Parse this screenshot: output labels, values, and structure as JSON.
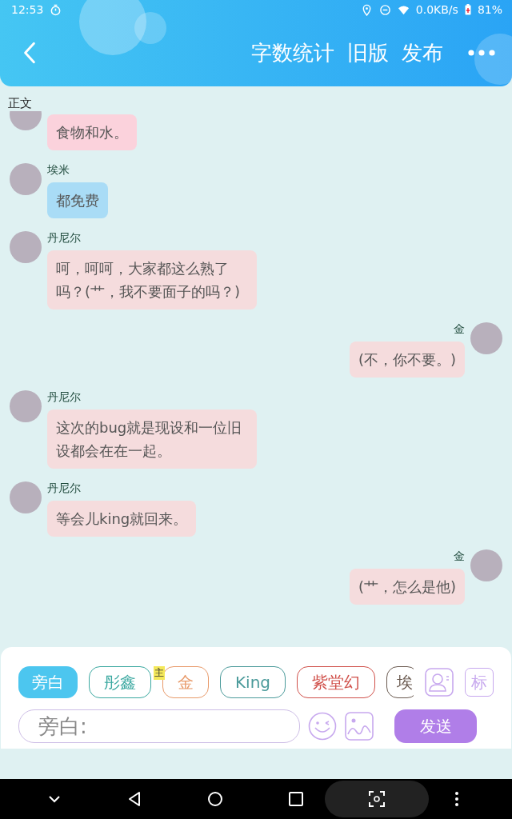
{
  "status_bar": {
    "time": "12:53",
    "network_speed": "0.0KB/s",
    "battery": "81%"
  },
  "header": {
    "actions": [
      "字数统计",
      "旧版",
      "发布"
    ]
  },
  "section_label": "正文",
  "messages": [
    {
      "kind": "left",
      "text": "食物和水。",
      "color": "#fbd2dc"
    },
    {
      "kind": "left",
      "name": "埃米",
      "text": "都免费",
      "color": "#a9dcf6"
    },
    {
      "kind": "left",
      "name": "丹尼尔",
      "text": "呵，呵呵，大家都这么熟了吗？(艹，我不要面子的吗？)",
      "color": "#f5dcdd"
    },
    {
      "kind": "right",
      "name": "金",
      "text": "(不，你不要。)",
      "color": "#f5dcdd"
    },
    {
      "kind": "left",
      "name": "丹尼尔",
      "text": "这次的bug就是现设和一位旧设都会在在一起。",
      "color": "#f5dcdd"
    },
    {
      "kind": "left",
      "name": "丹尼尔",
      "text": "等会儿king就回来。",
      "color": "#f5dcdd"
    },
    {
      "kind": "right",
      "name": "金",
      "text": "(艹，怎么是他)",
      "color": "#f5dcdd"
    }
  ],
  "characters": [
    {
      "label": "旁白",
      "selected": true,
      "color": "#4cc6ef"
    },
    {
      "label": "彤鑫",
      "selected": false,
      "color": "#3aa8a0"
    },
    {
      "label": "金",
      "selected": false,
      "color": "#e89a6a",
      "badge": "主"
    },
    {
      "label": "King",
      "selected": false,
      "color": "#4a9a9a"
    },
    {
      "label": "紫堂幻",
      "selected": false,
      "color": "#d0504a"
    },
    {
      "label": "埃",
      "selected": false,
      "color": "#6a5a50"
    }
  ],
  "mark_button": "标",
  "input": {
    "placeholder": "旁白:"
  },
  "send_button": "发送"
}
